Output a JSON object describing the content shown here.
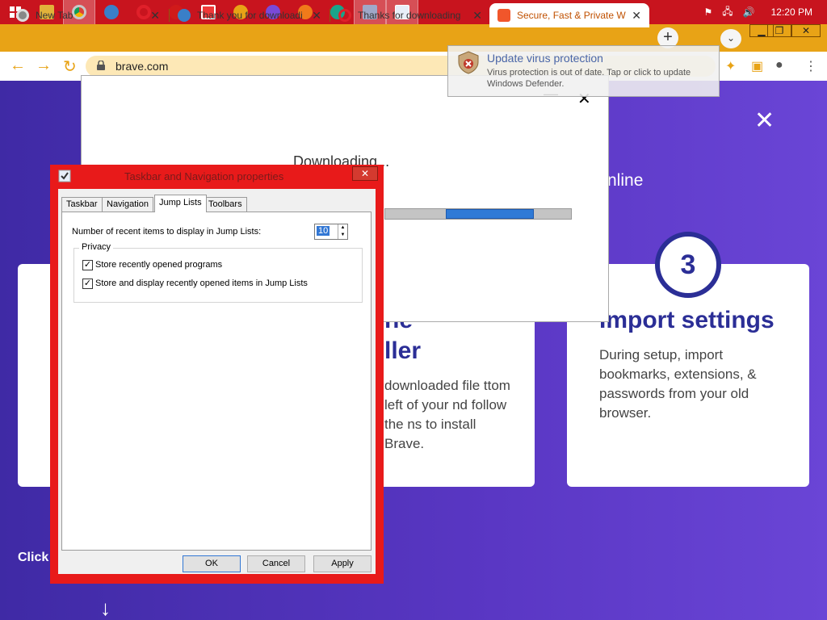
{
  "taskbar": {
    "time": "12:20 PM",
    "accent": "#c8141e",
    "pinned": [
      {
        "name": "file-explorer-icon",
        "color": "#e2b23a"
      },
      {
        "name": "chrome-icon",
        "color": "#3a8dd1"
      },
      {
        "name": "ie-icon",
        "color": "#3a7fc8"
      },
      {
        "name": "opera-icon",
        "color": "#e0202a"
      },
      {
        "name": "opera-gx-icon",
        "color": "#d01a1a"
      },
      {
        "name": "vivaldi-icon",
        "color": "#ef3939"
      },
      {
        "name": "chrome-canary-icon",
        "color": "#e8a316"
      },
      {
        "name": "chrome-beta-icon",
        "color": "#7a4ad8"
      },
      {
        "name": "firefox-icon",
        "color": "#f07a1a"
      },
      {
        "name": "edge-icon",
        "color": "#1aa38a"
      },
      {
        "name": "tool-icon",
        "color": "#a0a8c8"
      },
      {
        "name": "taskbar-props-icon",
        "color": "#c0c8d8"
      }
    ]
  },
  "browser": {
    "tabs": [
      {
        "title": "New Tab"
      },
      {
        "title": "Thank you for downloadi"
      },
      {
        "title": "Thanks for downloading"
      },
      {
        "title": "Secure, Fast & Private W"
      }
    ],
    "url": "brave.com",
    "accent": "#e8a316"
  },
  "notification": {
    "title": "Update virus protection",
    "body": "Virus protection is out of date. Tap or click to update Windows Defender."
  },
  "download_dialog": {
    "text": "Downloading...",
    "progress": 0.34
  },
  "page": {
    "online_text": "nline",
    "step_number": "3",
    "card3_heading": "Import settings",
    "card3_body": "During setup, import bookmarks, extensions, & passwords from your old browser.",
    "card2_heading_a": "he",
    "card2_heading_b": "ller",
    "card2_body": "downloaded file ttom left of your nd follow the ns to install Brave.",
    "click_text": "Click"
  },
  "props_dialog": {
    "title": "Taskbar and Navigation properties",
    "tabs": [
      "Taskbar",
      "Navigation",
      "Jump Lists",
      "Toolbars"
    ],
    "selected_tab": "Jump Lists",
    "recent_items_label": "Number of recent items to display in Jump Lists:",
    "recent_items_value": "10",
    "privacy_label": "Privacy",
    "check1_label": "Store recently opened programs",
    "check2_label": "Store and display recently opened items in Jump Lists",
    "check1": true,
    "check2": true,
    "ok_label": "OK",
    "cancel_label": "Cancel",
    "apply_label": "Apply"
  }
}
